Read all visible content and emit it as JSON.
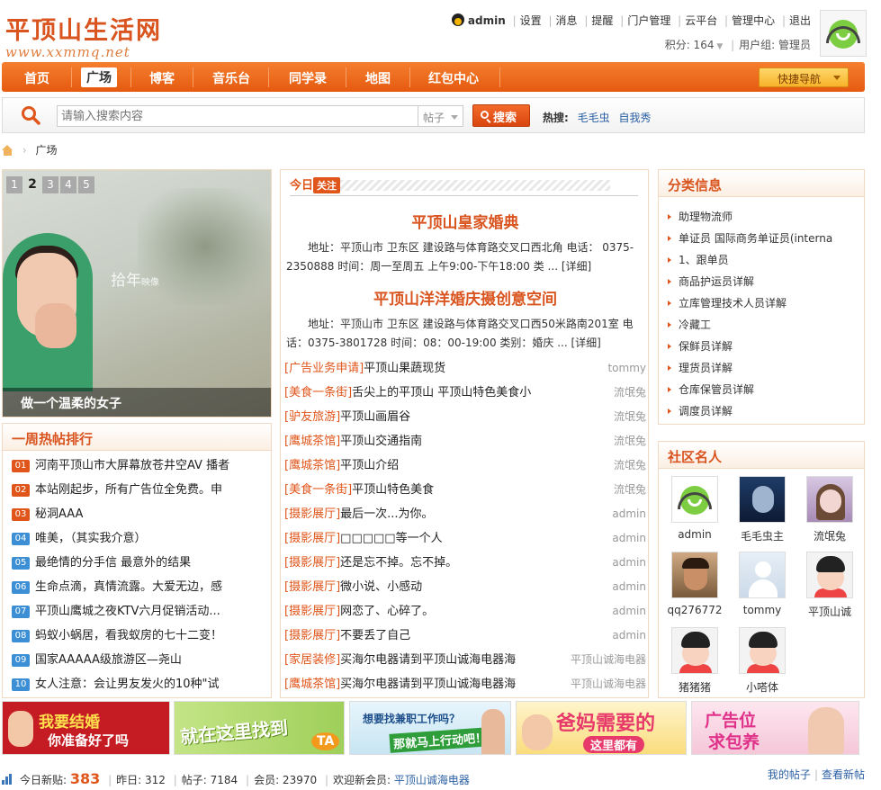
{
  "site": {
    "logo_text": "平顶山生活网",
    "logo_url_text": "www.xxmmq.net"
  },
  "usernav": {
    "username": "admin",
    "links": [
      "设置",
      "消息",
      "提醒",
      "门户管理",
      "云平台",
      "管理中心",
      "退出"
    ]
  },
  "userinfo": {
    "credits_label": "积分: 164",
    "group_label": "用户组: 管理员"
  },
  "nav": {
    "items": [
      "首页",
      "广场",
      "博客",
      "音乐台",
      "同学录",
      "地图",
      "红包中心"
    ],
    "active": "广场",
    "quick_nav": "快捷导航"
  },
  "search": {
    "placeholder": "请输入搜索内容",
    "type": "帖子",
    "button": "搜索",
    "hot_label": "热搜:",
    "hot_terms": [
      "毛毛虫",
      "自我秀"
    ]
  },
  "breadcrumb": {
    "current": "广场"
  },
  "slideshow": {
    "pages": [
      "1",
      "2",
      "3",
      "4",
      "5"
    ],
    "active_page": "2",
    "caption": "做一个温柔的女子",
    "watermark": "拾年",
    "watermark_small": "映像"
  },
  "weekly": {
    "title": "一周热帖排行",
    "items": [
      {
        "rank": "01",
        "title": "河南平顶山市大屏幕放苍井空AV 播者"
      },
      {
        "rank": "02",
        "title": "本站刚起步，所有广告位全免费。申"
      },
      {
        "rank": "03",
        "title": "秘洞AAA"
      },
      {
        "rank": "04",
        "title": "唯美，（其实我介意）"
      },
      {
        "rank": "05",
        "title": "最绝情的分手信 最意外的结果"
      },
      {
        "rank": "06",
        "title": "生命点滴，真情流露。大爱无边，感"
      },
      {
        "rank": "07",
        "title": "平顶山鹰城之夜KTV六月促销活动..."
      },
      {
        "rank": "08",
        "title": "蚂蚁小蜗居，看我蚁房的七十二变！"
      },
      {
        "rank": "09",
        "title": "国家AAAAA级旅游区—尧山"
      },
      {
        "rank": "10",
        "title": "女人注意：会让男友发火的10种\"试"
      }
    ]
  },
  "today": {
    "label": "今日",
    "tag": "关注",
    "features": [
      {
        "title": "平顶山皇家婚典",
        "desc": "地址：平顶山市 卫东区 建设路与体育路交叉口西北角 电话： 0375-2350888 时间：周一至周五 上午9:00-下午18:00 类 ...",
        "more": "[详细]"
      },
      {
        "title": "平顶山洋洋婚庆摄创意空间",
        "desc": "地址：平顶山市 卫东区 建设路与体育路交叉口西50米路南201室 电话：0375-3801728 时间：08：00-19:00 类别：婚庆 ...",
        "more": "[详细]"
      }
    ],
    "threads": [
      {
        "cat": "[广告业务申请]",
        "title": "平顶山果蔬现货",
        "author": "tommy"
      },
      {
        "cat": "[美食一条街]",
        "title": "舌尖上的平顶山 平顶山特色美食小",
        "author": "流氓兔"
      },
      {
        "cat": "[驴友旅游]",
        "title": "平顶山画眉谷",
        "author": "流氓兔"
      },
      {
        "cat": "[鹰城茶馆]",
        "title": "平顶山交通指南",
        "author": "流氓兔"
      },
      {
        "cat": "[鹰城茶馆]",
        "title": "平顶山介绍",
        "author": "流氓兔"
      },
      {
        "cat": "[美食一条街]",
        "title": "平顶山特色美食",
        "author": "流氓兔"
      },
      {
        "cat": "[摄影展厅]",
        "title": "最后一次...为你。",
        "author": "admin"
      },
      {
        "cat": "[摄影展厅]",
        "title": "□□□□□等一个人",
        "author": "admin"
      },
      {
        "cat": "[摄影展厅]",
        "title": "还是忘不掉。忘不掉。",
        "author": "admin"
      },
      {
        "cat": "[摄影展厅]",
        "title": "微小说、小感动",
        "author": "admin"
      },
      {
        "cat": "[摄影展厅]",
        "title": "网恋了、心碎了。",
        "author": "admin"
      },
      {
        "cat": "[摄影展厅]",
        "title": "不要丢了自己",
        "author": "admin"
      },
      {
        "cat": "[家居装修]",
        "title": "买海尔电器请到平顶山诚海电器海",
        "author": "平顶山诚海电器"
      },
      {
        "cat": "[鹰城茶馆]",
        "title": "买海尔电器请到平顶山诚海电器海",
        "author": "平顶山诚海电器"
      }
    ]
  },
  "classify": {
    "title": "分类信息",
    "items": [
      "助理物流师",
      "单证员 国际商务单证员(interna",
      "1、跟单员",
      "商品护运员详解",
      "立库管理技术人员详解",
      "冷藏工",
      "保鲜员详解",
      "理货员详解",
      "仓库保管员详解",
      "调度员详解"
    ]
  },
  "famous": {
    "title": "社区名人",
    "members": [
      {
        "name": "admin",
        "avatar": "android-avatar"
      },
      {
        "name": "毛毛虫主",
        "avatar": "dark-avatar"
      },
      {
        "name": "流氓兔",
        "avatar": "girl-avatar"
      },
      {
        "name": "qq276772",
        "avatar": "man-avatar"
      },
      {
        "name": "tommy",
        "avatar": "default-avatar"
      },
      {
        "name": "平顶山诚",
        "avatar": "cartoon-boy-avatar"
      },
      {
        "name": "猪猪猪",
        "avatar": "cartoon-boy-avatar"
      },
      {
        "name": "小嗒体",
        "avatar": "cartoon-boy-avatar"
      }
    ]
  },
  "banners": [
    {
      "text1": "我要结婚",
      "text2": "你准备好了吗",
      "bg": "#c41c22"
    },
    {
      "text1": "就在这里找到",
      "text2": "TA",
      "bg": "#b8db78"
    },
    {
      "text1": "想要找兼职工作吗？",
      "text2": "那就马上行动吧！",
      "bg": "#d6ecf7"
    },
    {
      "text1": "爸妈需要的",
      "text2": "这里都有",
      "bg": "#fbe8a4"
    },
    {
      "text1": "广告位",
      "text2": "求包养",
      "bg": "#f7dde8"
    }
  ],
  "footer": {
    "today_label": "今日新贴:",
    "today_value": "383",
    "yesterday": "昨日: 312",
    "posts": "帖子: 7184",
    "members": "会员: 23970",
    "newest_label": "欢迎新会员:",
    "newest_member": "平顶山诚海电器",
    "my_posts": "我的帖子",
    "new_posts": "查看新帖"
  },
  "colors": {
    "accent": "#e0551a",
    "nav_bg": "#f07026",
    "link": "#2a5fa3",
    "panel_border": "#f1d9c2"
  }
}
